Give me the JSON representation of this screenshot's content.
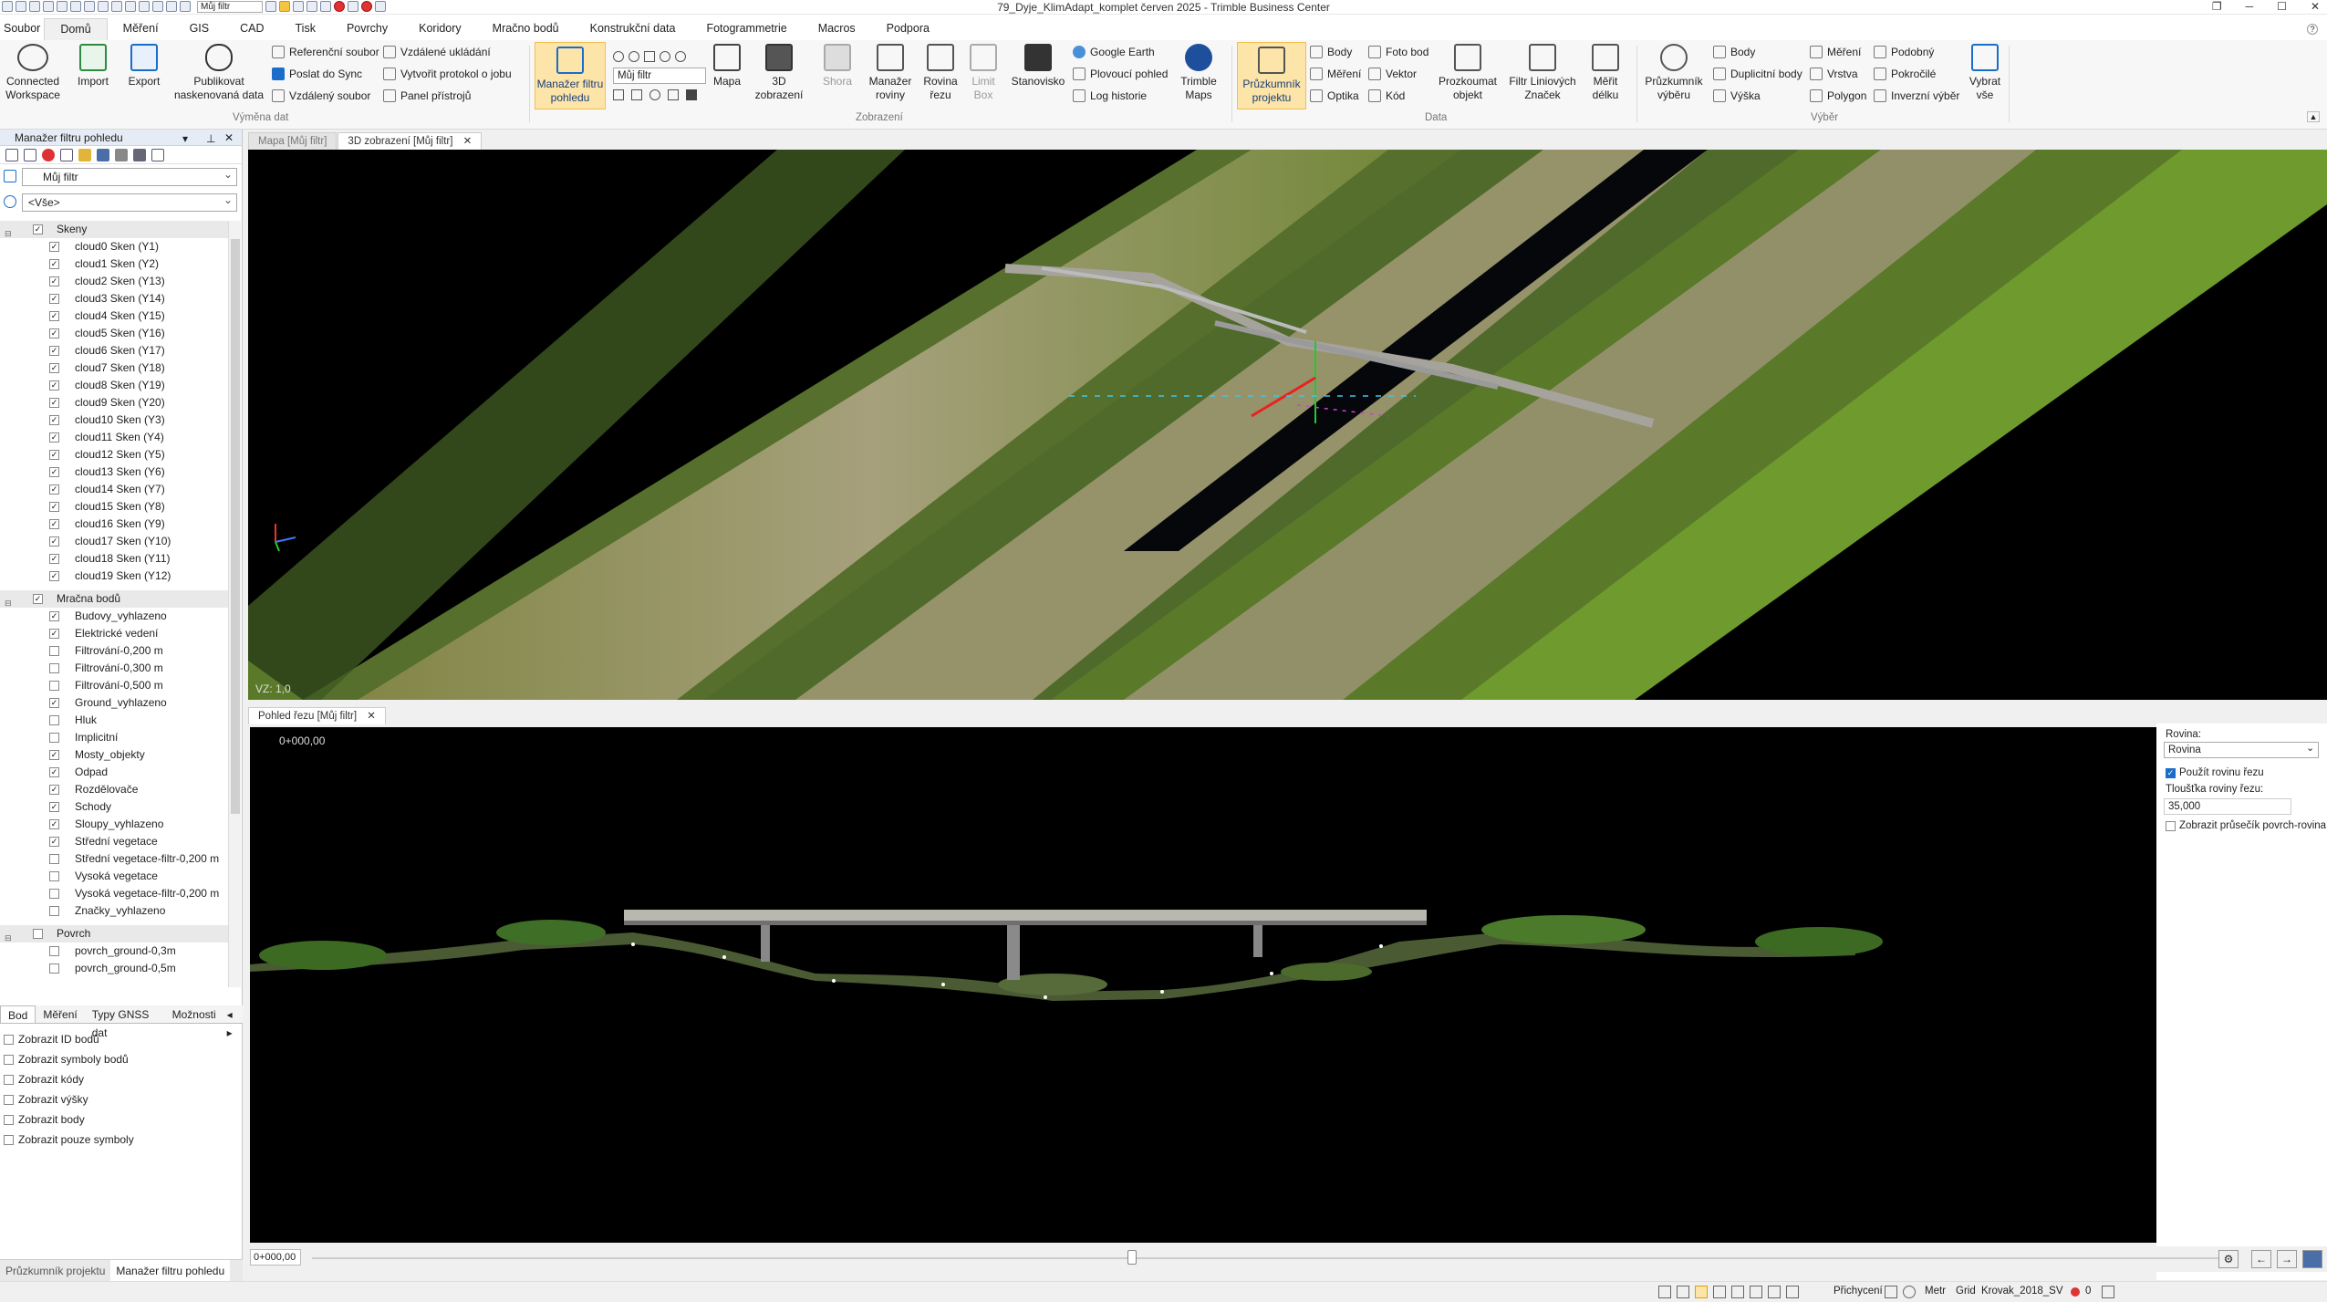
{
  "window": {
    "title": "79_Dyje_KlimAdapt_komplet červen 2025 - Trimble Business Center",
    "quick_filter": "Můj filtr",
    "help": "?"
  },
  "menu": [
    "Soubor",
    "Domů",
    "Měření",
    "GIS",
    "CAD",
    "Tisk",
    "Povrchy",
    "Koridory",
    "Mračno bodů",
    "Konstrukční data",
    "Fotogrammetrie",
    "Macros",
    "Podpora"
  ],
  "ribbon": {
    "connected_workspace": "Connected\nWorkspace",
    "import": "Import",
    "export": "Export",
    "publish": "Publikovat\nnaskenovaná data",
    "referencni_soubor": "Referenční soubor",
    "poslat_do_sync": "Poslat do Sync",
    "vzdaleny_soubor": "Vzdálený soubor",
    "vzdalene_ukladani": "Vzdálené ukládání",
    "vytvorit_protokol": "Vytvořit protokol o jobu",
    "panel_pristroju": "Panel přístrojů",
    "group_vymena_dat": "Výměna dat",
    "manazer_filtru": "Manažer filtru\npohledu",
    "filter_value": "Můj filtr",
    "mapa": "Mapa",
    "zobrazeni_3d": "3D\nzobrazení",
    "shora": "Shora",
    "manazer_roviny": "Manažer\nroviny",
    "rovina_rezu": "Rovina\nřezu",
    "limit_box": "Limit\nBox",
    "stanovisko": "Stanovisko",
    "google_earth": "Google Earth",
    "plovouci_pohled": "Plovoucí pohled",
    "log_historie": "Log historie",
    "trimble_maps": "Trimble\nMaps",
    "group_zobrazeni": "Zobrazení",
    "pruzkumnik_projektu": "Průzkumník\nprojektu",
    "body": "Body",
    "mereni": "Měření",
    "optika": "Optika",
    "foto_bod": "Foto bod",
    "vektor": "Vektor",
    "kod": "Kód",
    "prozkoumat_objekt": "Prozkoumat\nobjekt",
    "filtr_liniovych": "Filtr Liniových\nZnaček",
    "merit_delku": "Měřit\ndélku",
    "group_data": "Data",
    "pruzkumnik_vyberu": "Průzkumník\nvýběru",
    "vyber_body": "Body",
    "duplicitni_body": "Duplicitní body",
    "vyska": "Výška",
    "vyber_mereni": "Měření",
    "vrstva": "Vrstva",
    "polygon": "Polygon",
    "podobny": "Podobný",
    "pokrocile": "Pokročilé",
    "inverzni_vyber": "Inverzní výběr",
    "vybrat_vse": "Vybrat\nvše",
    "group_vyber": "Výběr"
  },
  "left_panel": {
    "title": "Manažer filtru pohledu",
    "filter": "Můj filtr",
    "scope": "<Vše>",
    "groups": [
      {
        "name": "Skeny",
        "checked": true,
        "items": [
          {
            "label": "cloud0 Sken (Y1)",
            "checked": true
          },
          {
            "label": "cloud1 Sken (Y2)",
            "checked": true
          },
          {
            "label": "cloud2 Sken (Y13)",
            "checked": true
          },
          {
            "label": "cloud3 Sken (Y14)",
            "checked": true
          },
          {
            "label": "cloud4 Sken (Y15)",
            "checked": true
          },
          {
            "label": "cloud5 Sken (Y16)",
            "checked": true
          },
          {
            "label": "cloud6 Sken (Y17)",
            "checked": true
          },
          {
            "label": "cloud7 Sken (Y18)",
            "checked": true
          },
          {
            "label": "cloud8 Sken (Y19)",
            "checked": true
          },
          {
            "label": "cloud9 Sken (Y20)",
            "checked": true
          },
          {
            "label": "cloud10 Sken (Y3)",
            "checked": true
          },
          {
            "label": "cloud11 Sken (Y4)",
            "checked": true
          },
          {
            "label": "cloud12 Sken (Y5)",
            "checked": true
          },
          {
            "label": "cloud13 Sken (Y6)",
            "checked": true
          },
          {
            "label": "cloud14 Sken (Y7)",
            "checked": true
          },
          {
            "label": "cloud15 Sken (Y8)",
            "checked": true
          },
          {
            "label": "cloud16 Sken (Y9)",
            "checked": true
          },
          {
            "label": "cloud17 Sken (Y10)",
            "checked": true
          },
          {
            "label": "cloud18 Sken (Y11)",
            "checked": true
          },
          {
            "label": "cloud19 Sken (Y12)",
            "checked": true
          }
        ]
      },
      {
        "name": "Mračna bodů",
        "checked": true,
        "items": [
          {
            "label": "Budovy_vyhlazeno",
            "checked": true
          },
          {
            "label": "Elektrické vedení",
            "checked": true
          },
          {
            "label": "Filtrování-0,200 m",
            "checked": false
          },
          {
            "label": "Filtrování-0,300 m",
            "checked": false
          },
          {
            "label": "Filtrování-0,500 m",
            "checked": false
          },
          {
            "label": "Ground_vyhlazeno",
            "checked": true
          },
          {
            "label": "Hluk",
            "checked": false
          },
          {
            "label": "Implicitní",
            "checked": false
          },
          {
            "label": "Mosty_objekty",
            "checked": true
          },
          {
            "label": "Odpad",
            "checked": true
          },
          {
            "label": "Rozdělovače",
            "checked": true
          },
          {
            "label": "Schody",
            "checked": true
          },
          {
            "label": "Sloupy_vyhlazeno",
            "checked": true
          },
          {
            "label": "Střední vegetace",
            "checked": true
          },
          {
            "label": "Střední vegetace-filtr-0,200 m",
            "checked": false
          },
          {
            "label": "Vysoká vegetace",
            "checked": false
          },
          {
            "label": "Vysoká vegetace-filtr-0,200 m",
            "checked": false
          },
          {
            "label": "Značky_vyhlazeno",
            "checked": false
          }
        ]
      },
      {
        "name": "Povrch",
        "checked": false,
        "items": [
          {
            "label": "povrch_ground-0,3m",
            "checked": false
          },
          {
            "label": "povrch_ground-0,5m",
            "checked": false
          }
        ]
      }
    ],
    "bottom_tabs": [
      "Bod",
      "Měření",
      "Typy GNSS dat",
      "Možnosti"
    ],
    "options": [
      "Zobrazit ID bodů",
      "Zobrazit symboly bodů",
      "Zobrazit kódy",
      "Zobrazit výšky",
      "Zobrazit body",
      "Zobrazit pouze symboly"
    ],
    "panel_tabs": [
      "Průzkumník projektu",
      "Manažer filtru pohledu"
    ]
  },
  "doc_tabs_top": [
    "Mapa [Můj filtr]",
    "3D zobrazení [Můj filtr]"
  ],
  "view3d": {
    "vz": "VZ: 1,0"
  },
  "doc_tab_section": "Pohled řezu [Můj filtr]",
  "section": {
    "station": "0+000,00",
    "station_input": "0+000,00",
    "slider_position": 0.43
  },
  "props": {
    "rovina_label": "Rovina:",
    "rovina_value": "Rovina",
    "pouzit_rovinu": "Použít rovinu řezu",
    "pouzit_checked": true,
    "tloustka_label": "Tloušťka roviny řezu:",
    "tloustka_value": "35,000",
    "zobrazit_prusecik": "Zobrazit průsečík povrch-rovina",
    "prusecik_checked": false
  },
  "status": {
    "unit": "Metr",
    "grid": "Grid",
    "crs": "Krovak_2018_SV",
    "count": "0",
    "snap": "Přichycení"
  },
  "colors": {
    "accent": "#1a6dc9",
    "highlight": "#fde4a8",
    "viewport_bg": "#000000"
  }
}
